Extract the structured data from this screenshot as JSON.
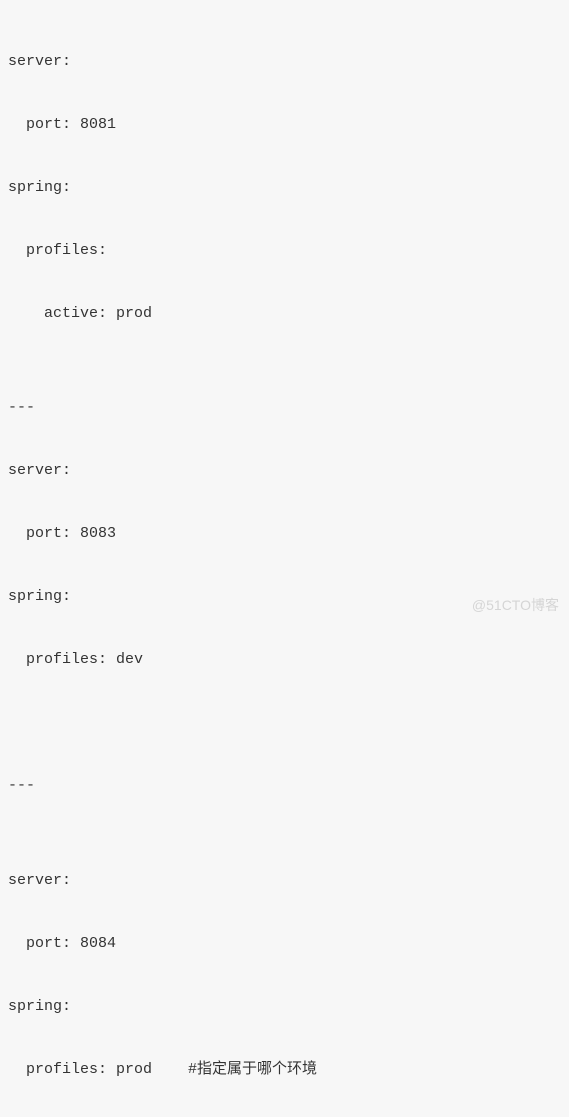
{
  "lines": {
    "l1": "server:",
    "l2": "port: 8081",
    "l3": "spring:",
    "l4": "profiles:",
    "l5": "active: prod",
    "l6": "",
    "l7": "---",
    "l8": "server:",
    "l9": "port: 8083",
    "l10": "spring:",
    "l11": "profiles: dev",
    "l12": "",
    "l13": "",
    "l14": "---",
    "l15": "",
    "l16": "server:",
    "l17": "port: 8084",
    "l18": "spring:",
    "l19a": "profiles: prod  ",
    "l19b": "#指定属于哪个环境"
  },
  "watermark": "@51CTO博客",
  "chart_data": {
    "type": "table",
    "title": "Spring Boot multi-document YAML configuration",
    "documents": [
      {
        "server": {
          "port": 8081
        },
        "spring": {
          "profiles": {
            "active": "prod"
          }
        }
      },
      {
        "server": {
          "port": 8083
        },
        "spring": {
          "profiles": "dev"
        }
      },
      {
        "server": {
          "port": 8084
        },
        "spring": {
          "profiles": "prod"
        },
        "comment": "#指定属于哪个环境"
      }
    ]
  }
}
